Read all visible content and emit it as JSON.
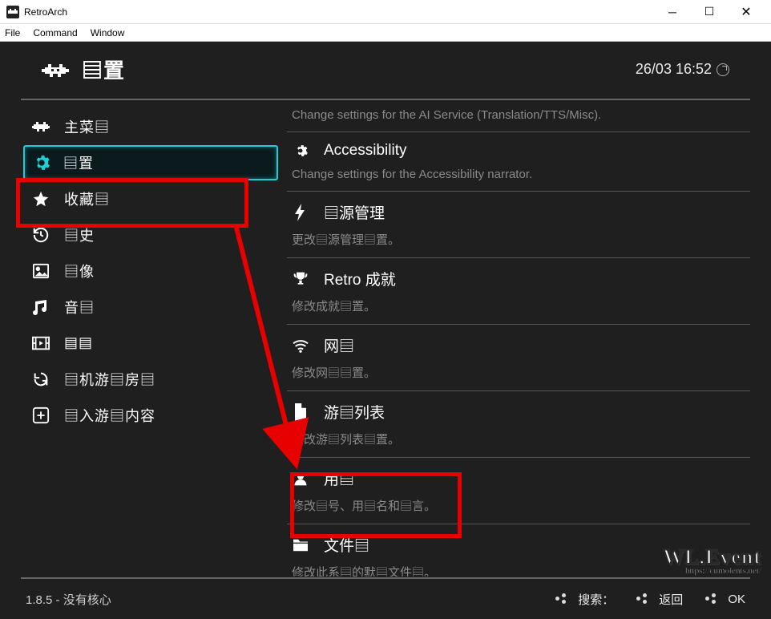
{
  "window": {
    "title": "RetroArch",
    "menus": [
      "File",
      "Command",
      "Window"
    ]
  },
  "header": {
    "title": "▤置",
    "datetime": "26/03 16:52"
  },
  "sidebar": {
    "items": [
      {
        "icon": "invader-icon",
        "label": "主菜▤"
      },
      {
        "icon": "gear-icon",
        "label": "▤置",
        "selected": true
      },
      {
        "icon": "star-icon",
        "label": "收藏▤"
      },
      {
        "icon": "history-icon",
        "label": "▤史"
      },
      {
        "icon": "image-icon",
        "label": "▤像"
      },
      {
        "icon": "music-icon",
        "label": "音▤"
      },
      {
        "icon": "video-icon",
        "label": "▤▤"
      },
      {
        "icon": "netplay-icon",
        "label": "▤机游▤房▤"
      },
      {
        "icon": "plus-icon",
        "label": "▤入游▤内容"
      }
    ]
  },
  "sections": [
    {
      "title": "",
      "icon": "",
      "desc": "Change settings for the AI Service (Translation/TTS/Misc)."
    },
    {
      "title": "Accessibility",
      "icon": "gear-small-icon",
      "desc": "Change settings for the Accessibility narrator."
    },
    {
      "title": "▤源管理",
      "icon": "bolt-icon",
      "desc": "更改▤源管理▤置。"
    },
    {
      "title": "Retro 成就",
      "icon": "trophy-icon",
      "desc": "修改成就▤置。"
    },
    {
      "title": "网▤",
      "icon": "wifi-icon",
      "desc": "修改网▤▤置。"
    },
    {
      "title": "游▤列表",
      "icon": "file-icon",
      "desc": "修改游▤列表▤置。"
    },
    {
      "title": "用▤",
      "icon": "user-icon",
      "desc": "修改▤号、用▤名和▤言。"
    },
    {
      "title": "文件▤",
      "icon": "folder-icon",
      "desc": "修改此系▤的默▤文件▤。"
    }
  ],
  "footer": {
    "version": "1.8.5 - 没有核心",
    "actions": [
      {
        "label": "搜索："
      },
      {
        "label": "返回"
      },
      {
        "label": "OK"
      }
    ]
  },
  "watermark": {
    "main": "WL.Event",
    "sub": "https://cumolents.net/"
  }
}
